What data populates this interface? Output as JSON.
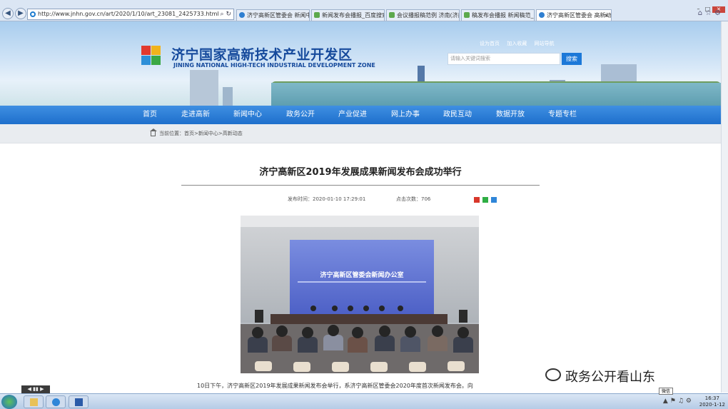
{
  "browser": {
    "address": "http://www.jnhn.gov.cn/art/2020/1/10/art_23081_2425733.html",
    "tabs": [
      {
        "label": "济宁高新区管委会 新闻中心"
      },
      {
        "label": "新闻发布会播报_百度搜索"
      },
      {
        "label": "会议播报稿范例 济南(济南)发布会..."
      },
      {
        "label": "稿发布会播报 新闻稿范_百度搜索"
      },
      {
        "label": "济宁高新区管委会 高新动..."
      }
    ]
  },
  "site": {
    "name": "济宁国家高新技术产业开发区",
    "name_en": "JINING NATIONAL HIGH-TECH INDUSTRIAL DEVELOPMENT ZONE",
    "top_links": [
      "设为首页",
      "加入收藏",
      "网站导航"
    ],
    "search_placeholder": "请输入关键词搜索",
    "search_button": "搜索"
  },
  "nav": {
    "items": [
      "首页",
      "走进高新",
      "新闻中心",
      "政务公开",
      "产业促进",
      "网上办事",
      "政民互动",
      "数据开放",
      "专题专栏"
    ]
  },
  "breadcrumb": "当前位置：首页>新闻中心>高新动态",
  "article": {
    "title": "济宁高新区2019年发展成果新闻发布会成功举行",
    "publish_time": "发布时间：2020-01-10 17:29:01",
    "views": "点击次数：706",
    "photo_caption": "济宁高新区管委会新闻办公室",
    "paragraph": "10日下午，济宁高新区2019年发展成果新闻发布会举行，系济宁高新区管委会2020年度首次新闻发布会。向"
  },
  "watermark": "政务公开看山东",
  "taskbar": {
    "time": "16:37",
    "date": "2020-1-12",
    "tooltip": "微信"
  }
}
